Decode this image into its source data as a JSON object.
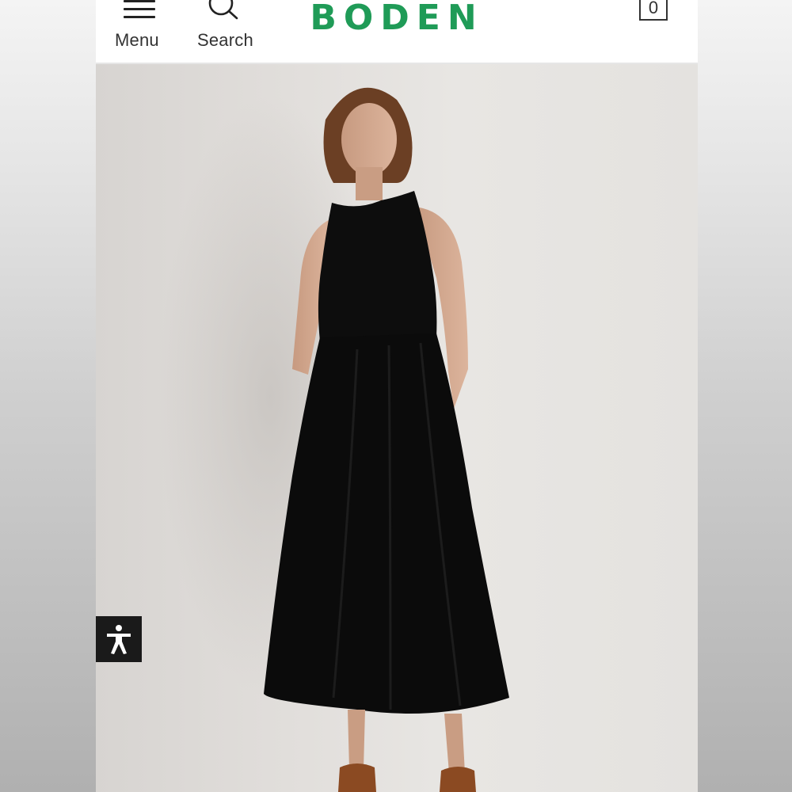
{
  "header": {
    "menu_label": "Menu",
    "search_label": "Search",
    "logo_text": "BODEN",
    "bag_count": "0"
  },
  "colors": {
    "brand_green": "#1f9b57",
    "dress": "#0d0d0d",
    "backdrop": "#e4e2df"
  },
  "icons": {
    "menu": "hamburger-icon",
    "search": "magnifier-icon",
    "bag": "shopping-bag-icon",
    "accessibility": "accessibility-person-icon"
  },
  "hero": {
    "subject": "model wearing black sleeveless midi dress"
  }
}
